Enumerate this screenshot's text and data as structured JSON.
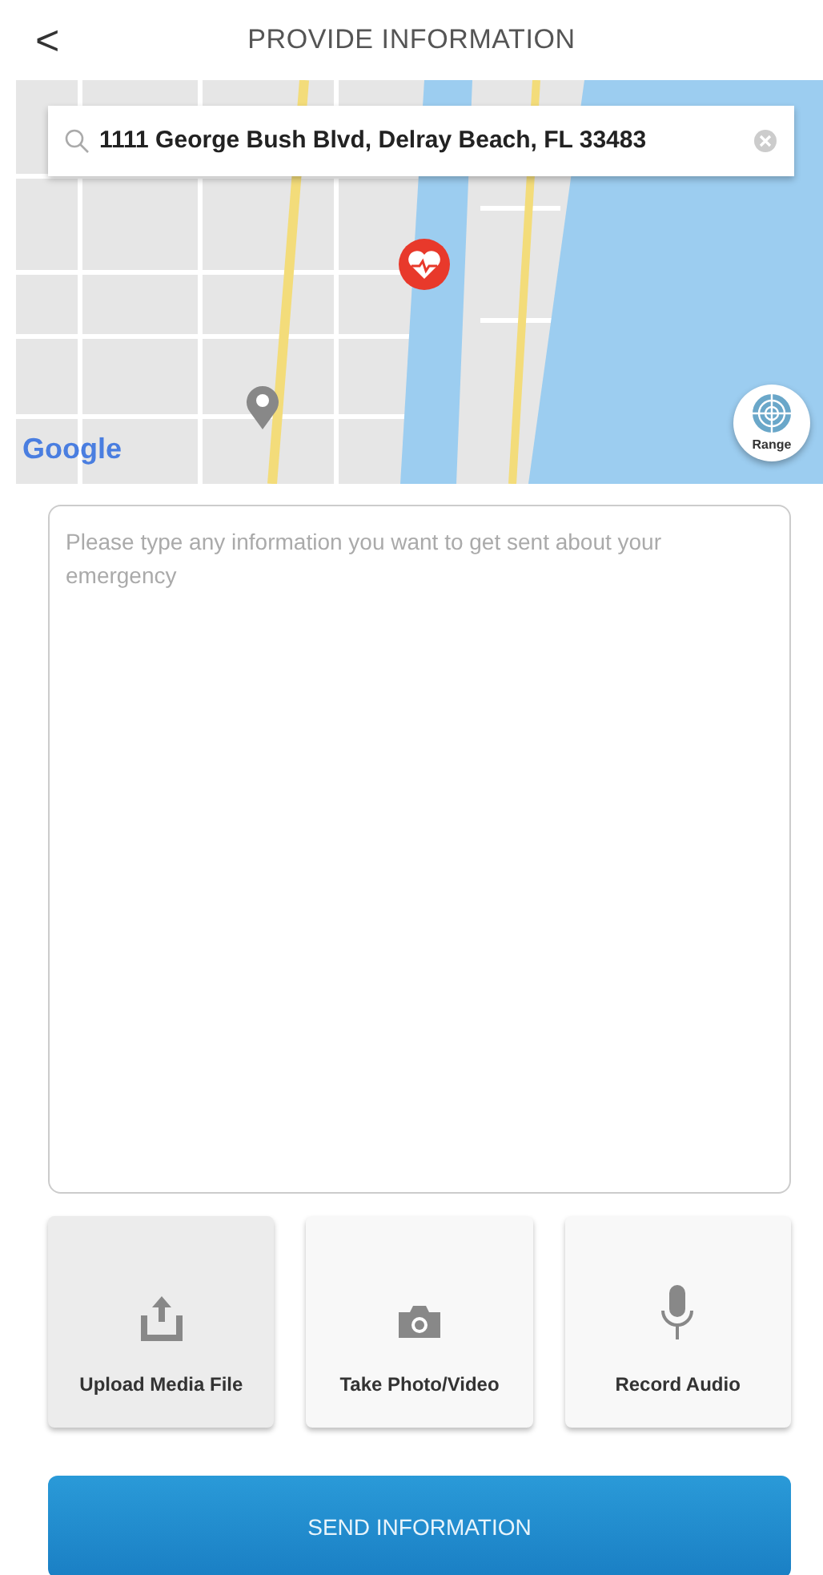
{
  "header": {
    "back": "<",
    "title": "PROVIDE INFORMATION"
  },
  "map": {
    "address": "1111 George Bush Blvd, Delray Beach, FL 33483",
    "attribution": "Google",
    "range_button": "Range"
  },
  "message": {
    "placeholder": "Please type any information you want to get sent about your emergency"
  },
  "actions": [
    {
      "kind": "upload",
      "label": "Upload Media File",
      "selected": true
    },
    {
      "kind": "camera",
      "label": "Take Photo/Video",
      "selected": false
    },
    {
      "kind": "microphone",
      "label": "Record Audio",
      "selected": false
    }
  ],
  "send_button": "SEND INFORMATION"
}
